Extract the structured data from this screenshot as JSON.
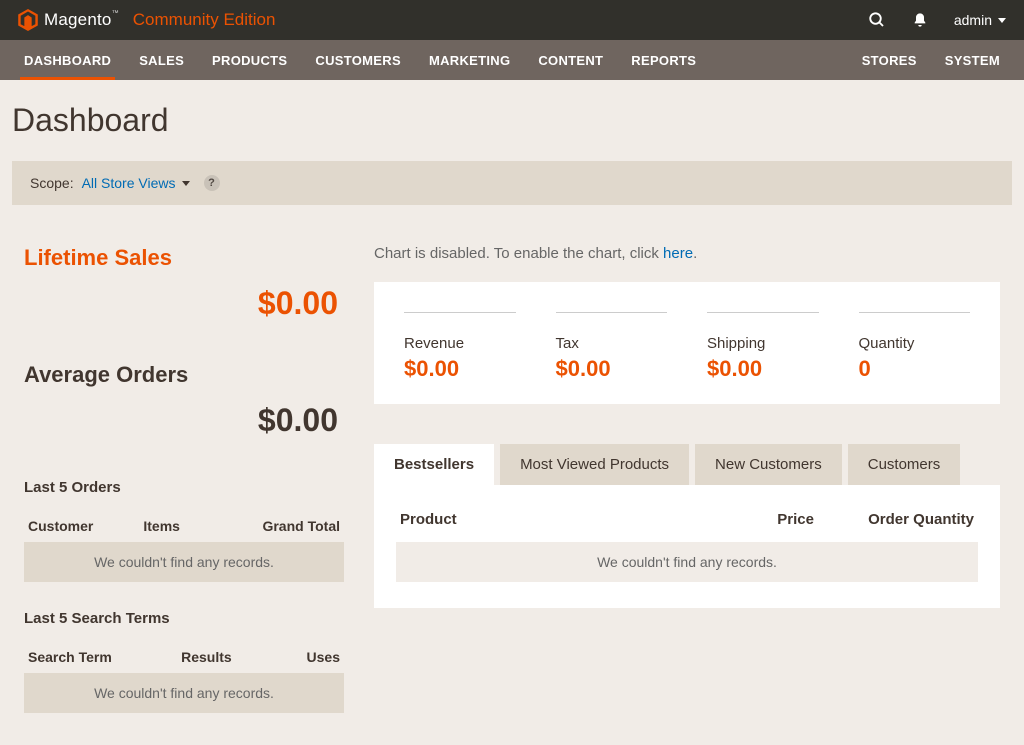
{
  "brand": {
    "name": "Magento",
    "edition": "Community Edition"
  },
  "topbar": {
    "user": "admin"
  },
  "nav": {
    "left": [
      "DASHBOARD",
      "SALES",
      "PRODUCTS",
      "CUSTOMERS",
      "MARKETING",
      "CONTENT",
      "REPORTS"
    ],
    "right": [
      "STORES",
      "SYSTEM"
    ],
    "active_index": 0
  },
  "page": {
    "title": "Dashboard"
  },
  "scope": {
    "label": "Scope:",
    "value": "All Store Views",
    "help": "?"
  },
  "left_metrics": {
    "lifetime_sales": {
      "label": "Lifetime Sales",
      "value": "$0.00"
    },
    "average_orders": {
      "label": "Average Orders",
      "value": "$0.00"
    }
  },
  "last_orders": {
    "title": "Last 5 Orders",
    "columns": [
      "Customer",
      "Items",
      "Grand Total"
    ],
    "empty_msg": "We couldn't find any records."
  },
  "last_searches": {
    "title": "Last 5 Search Terms",
    "columns": [
      "Search Term",
      "Results",
      "Uses"
    ],
    "empty_msg": "We couldn't find any records."
  },
  "chart_notice": {
    "prefix": "Chart is disabled. To enable the chart, click ",
    "link": "here",
    "suffix": "."
  },
  "stats": [
    {
      "label": "Revenue",
      "value": "$0.00"
    },
    {
      "label": "Tax",
      "value": "$0.00"
    },
    {
      "label": "Shipping",
      "value": "$0.00"
    },
    {
      "label": "Quantity",
      "value": "0"
    }
  ],
  "tabs": {
    "items": [
      "Bestsellers",
      "Most Viewed Products",
      "New Customers",
      "Customers"
    ],
    "active_index": 0
  },
  "bestsellers": {
    "columns": [
      "Product",
      "Price",
      "Order Quantity"
    ],
    "empty_msg": "We couldn't find any records."
  }
}
